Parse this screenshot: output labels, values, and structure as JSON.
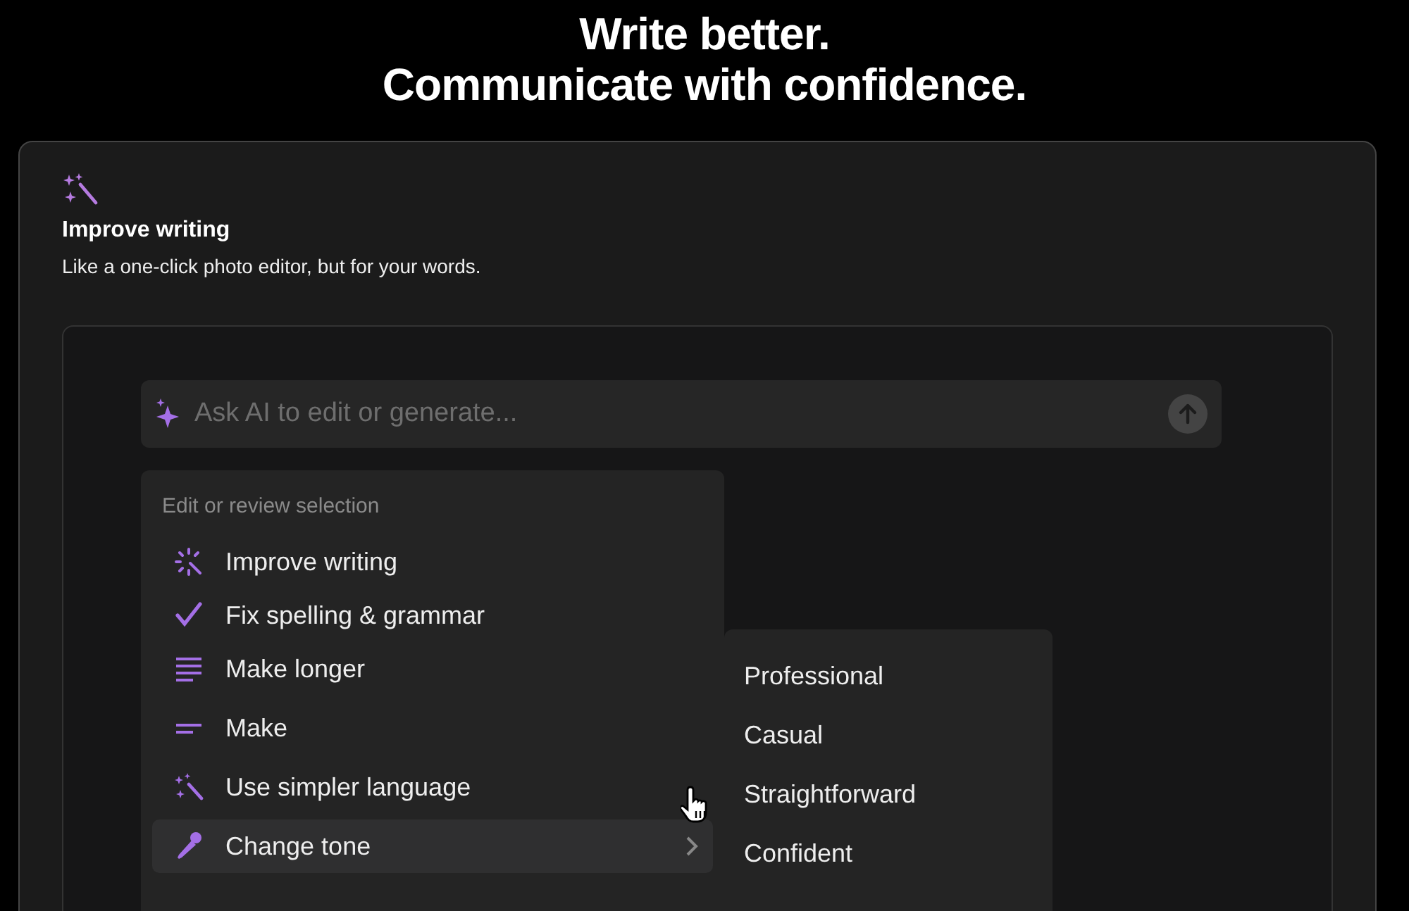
{
  "headline": [
    "Write better.",
    "Communicate with confidence."
  ],
  "feature": {
    "title": "Improve writing",
    "description": "Like a one-click photo editor, but for your words."
  },
  "prompt": {
    "placeholder": "Ask AI to edit or generate..."
  },
  "menu": {
    "heading": "Edit or review selection",
    "items": [
      {
        "kind": "sparkle",
        "label": "Improve writing",
        "selected": false,
        "submenu": false
      },
      {
        "kind": "check",
        "label": "Fix spelling & grammar",
        "selected": false,
        "submenu": false
      },
      {
        "kind": "lines",
        "label": "Make longer",
        "selected": false,
        "submenu": false
      },
      {
        "kind": "short",
        "label": "Make",
        "selected": false,
        "submenu": false
      },
      {
        "kind": "wand",
        "label": "Use simpler language",
        "selected": false,
        "submenu": false
      },
      {
        "kind": "mic",
        "label": "Change tone",
        "selected": true,
        "submenu": true
      }
    ]
  },
  "submenu": [
    "Professional",
    "Casual",
    "Straightforward",
    "Confident"
  ]
}
